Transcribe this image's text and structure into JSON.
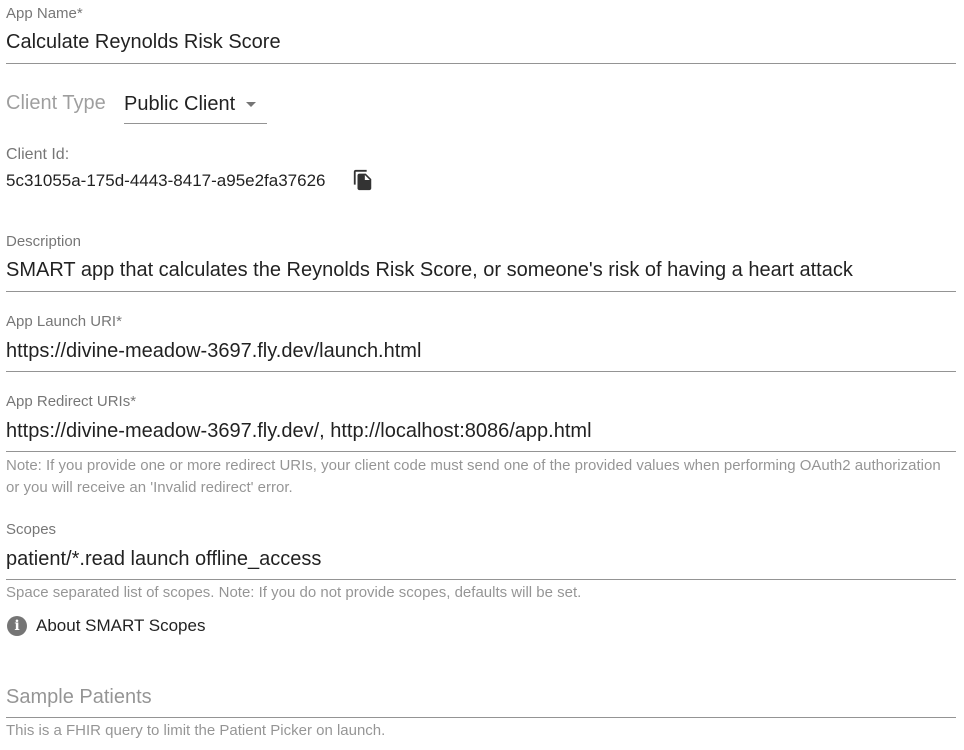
{
  "app_name": {
    "label": "App Name*",
    "value": "Calculate Reynolds Risk Score"
  },
  "client_type": {
    "label": "Client Type",
    "value": "Public Client",
    "icon": "chevron-down-icon"
  },
  "client_id": {
    "label": "Client Id:",
    "value": "5c31055a-175d-4443-8417-a95e2fa37626",
    "icon": "copy-icon"
  },
  "description": {
    "label": "Description",
    "value": "SMART app that calculates the Reynolds Risk Score, or someone's risk of having a heart attack"
  },
  "launch_uri": {
    "label": "App Launch URI*",
    "value": "https://divine-meadow-3697.fly.dev/launch.html"
  },
  "redirect_uris": {
    "label": "App Redirect URIs*",
    "value": "https://divine-meadow-3697.fly.dev/, http://localhost:8086/app.html",
    "helper": "Note: If you provide one or more redirect URIs, your client code must send one of the provided values when performing OAuth2 authorization or you will receive an 'Invalid redirect' error."
  },
  "scopes": {
    "label": "Scopes",
    "value": "patient/*.read launch offline_access",
    "helper": "Space separated list of scopes. Note: If you do not provide scopes, defaults will be set."
  },
  "about_scopes": {
    "label": "About SMART Scopes",
    "icon": "info-icon"
  },
  "sample_patients": {
    "placeholder": "Sample Patients",
    "helper": "This is a FHIR query to limit the Patient Picker on launch."
  }
}
